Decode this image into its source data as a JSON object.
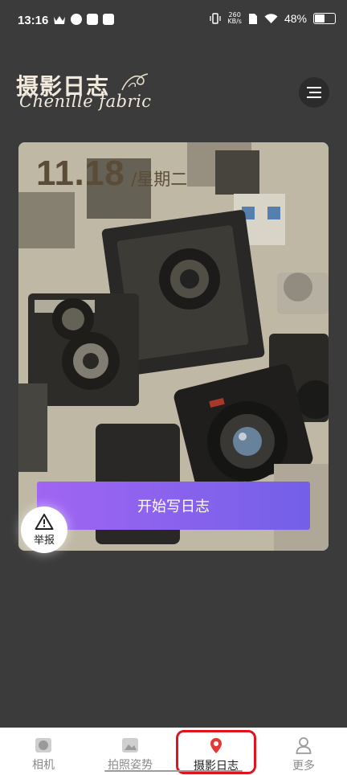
{
  "status_bar": {
    "time": "13:16",
    "net_speed_value": "260",
    "net_speed_unit": "KB/s",
    "battery": "48%",
    "battery_level": 0.48
  },
  "header": {
    "logo_cn": "摄影日志",
    "logo_en": "Chenille fabric",
    "menu_icon": "menu-icon"
  },
  "card": {
    "date": "11.18",
    "weekday": "/星期二",
    "start_button": "开始写日志"
  },
  "report": {
    "label": "举报",
    "icon": "warning-icon"
  },
  "tabs": [
    {
      "label": "相机",
      "icon": "camera-icon",
      "active": false
    },
    {
      "label": "拍照姿势",
      "icon": "image-icon",
      "active": false
    },
    {
      "label": "摄影日志",
      "icon": "location-pin-icon",
      "active": true
    },
    {
      "label": "更多",
      "icon": "person-icon",
      "active": false
    }
  ],
  "colors": {
    "background": "#3b3b3b",
    "button_gradient_start": "#a065f2",
    "button_gradient_end": "#7360e8",
    "active_tab_icon": "#e53935",
    "highlight_box": "#e1141e"
  }
}
